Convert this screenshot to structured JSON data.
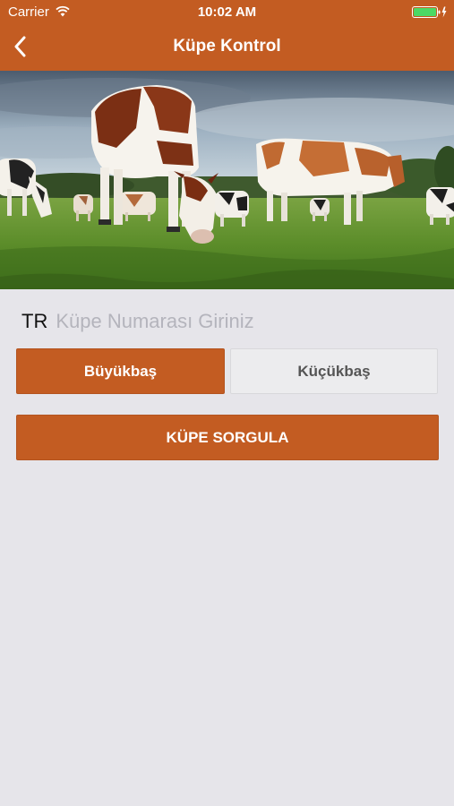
{
  "status_bar": {
    "carrier": "Carrier",
    "time": "10:02 AM",
    "icons": [
      "wifi-icon",
      "battery-icon",
      "charging-bolt-icon"
    ]
  },
  "nav": {
    "title": "Küpe Kontrol",
    "back_icon": "chevron-left-icon"
  },
  "hero": {
    "description_icon": "cows-grazing-photo"
  },
  "form": {
    "prefix": "TR",
    "placeholder": "Küpe Numarası Giriniz",
    "value": "",
    "segments": [
      {
        "label": "Büyükbaş",
        "selected": true
      },
      {
        "label": "Küçükbaş",
        "selected": false
      }
    ],
    "submit_label": "KÜPE SORGULA"
  },
  "colors": {
    "accent": "#c35c22",
    "background": "#e6e5ea",
    "segment_inactive": "#ececee"
  }
}
